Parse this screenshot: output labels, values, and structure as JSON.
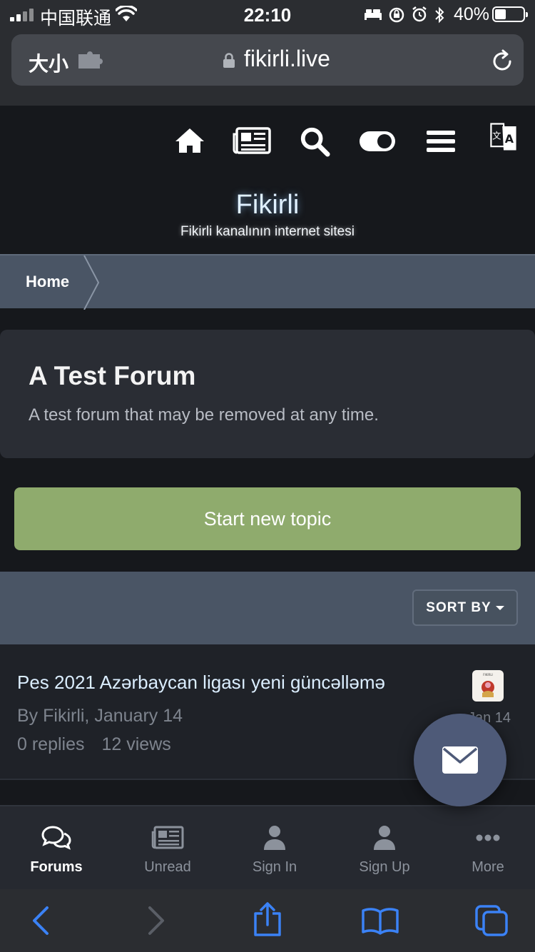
{
  "status_bar": {
    "carrier": "中国联通",
    "time": "22:10",
    "battery_percent": "40%",
    "battery_level": 0.4
  },
  "browser": {
    "text_size_label": "大小",
    "domain": "fikirli.live",
    "icons": [
      "extension-icon",
      "lock-icon",
      "reload-icon"
    ]
  },
  "site_header": {
    "icons": [
      "home-icon",
      "newspaper-icon",
      "search-icon",
      "theme-toggle-icon",
      "menu-icon",
      "translate-icon"
    ],
    "title": "Fikirli",
    "subtitle": "Fikirli kanalının internet sitesi"
  },
  "breadcrumb": {
    "items": [
      "Home"
    ]
  },
  "forum": {
    "title": "A Test Forum",
    "description": "A test forum that may be removed at any time.",
    "start_topic_label": "Start new topic",
    "sort_label": "SORT BY"
  },
  "topics": [
    {
      "title": "Pes 2021 Azərbaycan ligası yeni güncəlləmə",
      "meta": "By Fikirli, January 14",
      "replies": "0 replies",
      "views": "12 views",
      "last_post_date": "Jan 14",
      "avatar_text": "FIKIRLI"
    }
  ],
  "bottom_nav": {
    "items": [
      {
        "label": "Forums",
        "icon": "forums-icon",
        "active": true
      },
      {
        "label": "Unread",
        "icon": "newspaper-icon",
        "active": false
      },
      {
        "label": "Sign In",
        "icon": "user-icon",
        "active": false
      },
      {
        "label": "Sign Up",
        "icon": "user-icon",
        "active": false
      },
      {
        "label": "More",
        "icon": "more-icon",
        "active": false
      }
    ]
  },
  "safari_toolbar": {
    "icons": [
      "back-icon",
      "forward-icon",
      "share-icon",
      "bookmarks-icon",
      "tabs-icon"
    ]
  },
  "colors": {
    "accent_green": "#8fab6d",
    "accent_blue": "#3b82f6",
    "panel_blue": "#4a5565",
    "link_color": "#dbeeff"
  }
}
